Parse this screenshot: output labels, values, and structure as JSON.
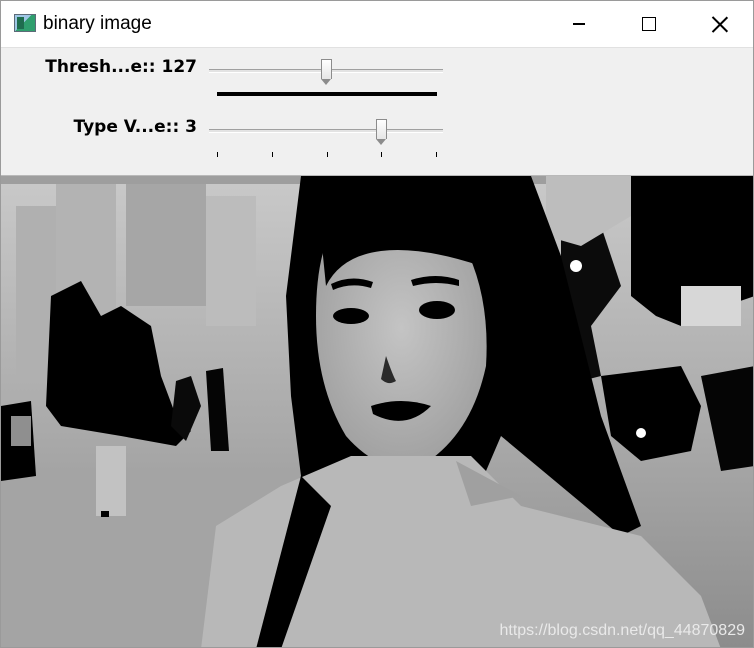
{
  "window": {
    "title": "binary image",
    "icon": "app-window-icon",
    "buttons": {
      "minimize": "minimize-icon",
      "maximize": "maximize-icon",
      "close": "close-icon"
    }
  },
  "trackbars": [
    {
      "label": "Thresh...e:: 127",
      "value": 127,
      "min": 0,
      "max": 255
    },
    {
      "label": "Type V...e:: 3",
      "value": 3,
      "min": 0,
      "max": 4,
      "ticks": [
        0,
        1,
        2,
        3,
        4
      ]
    }
  ],
  "image": {
    "content": "thresholded grayscale photo",
    "watermark": "https://blog.csdn.net/qq_44870829"
  }
}
